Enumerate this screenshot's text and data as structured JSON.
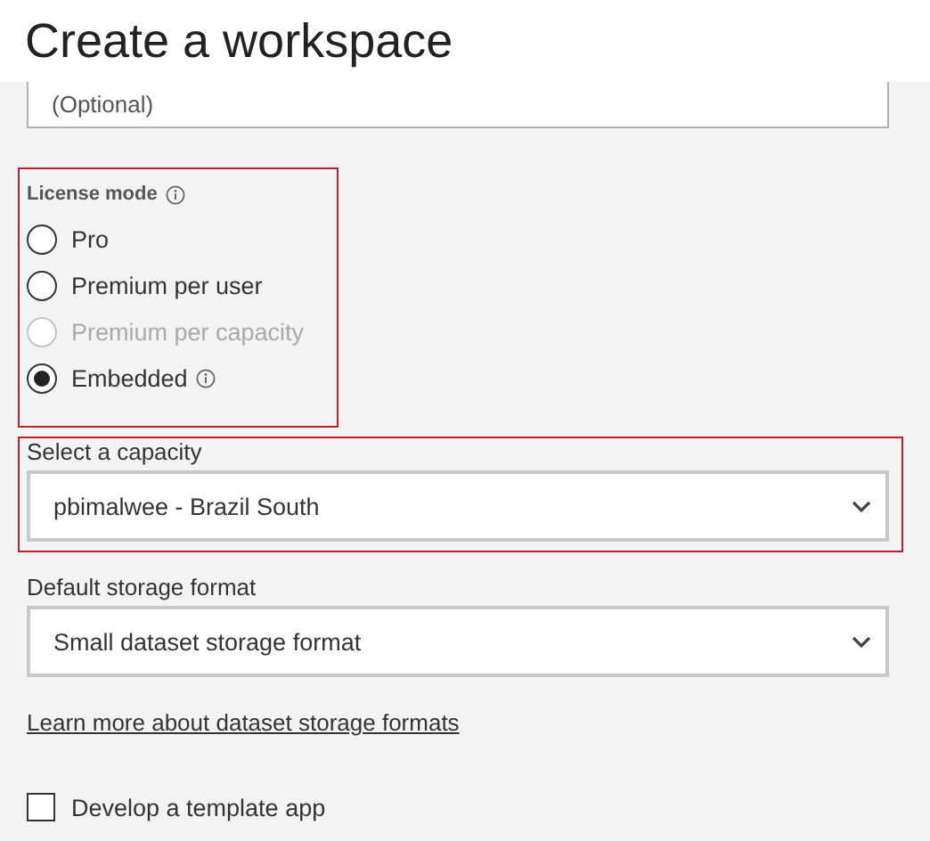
{
  "title": "Create a workspace",
  "description_field": {
    "placeholder": "(Optional)"
  },
  "license_mode": {
    "label": "License mode",
    "highlighted": true,
    "options": [
      {
        "label": "Pro",
        "selected": false,
        "disabled": false,
        "info": false
      },
      {
        "label": "Premium per user",
        "selected": false,
        "disabled": false,
        "info": false
      },
      {
        "label": "Premium per capacity",
        "selected": false,
        "disabled": true,
        "info": false
      },
      {
        "label": "Embedded",
        "selected": true,
        "disabled": false,
        "info": true
      }
    ]
  },
  "capacity": {
    "label": "Select a capacity",
    "value": "pbimalwee - Brazil South",
    "highlighted": true
  },
  "storage_format": {
    "label": "Default storage format",
    "value": "Small dataset storage format"
  },
  "link": "Learn more about dataset storage formats",
  "template_app": {
    "label": "Develop a template app",
    "checked": false
  }
}
